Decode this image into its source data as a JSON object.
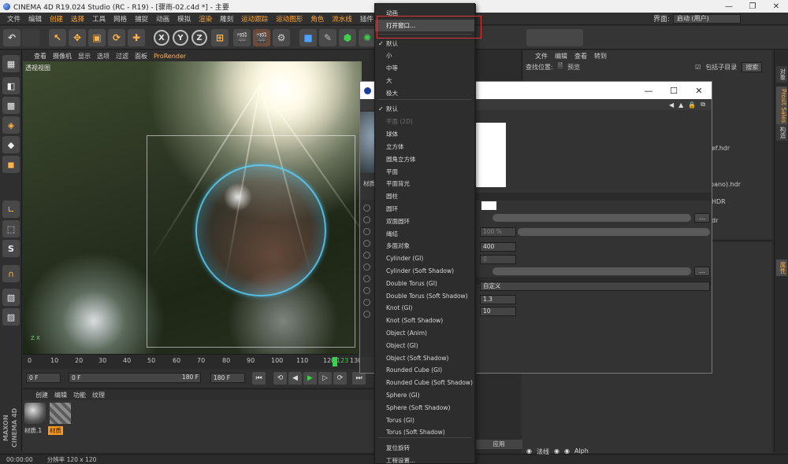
{
  "titlebar": {
    "title": "CINEMA 4D R19.024 Studio (RC - R19) - [骤雨-02.c4d *] - 主要",
    "controls": [
      "—",
      "❐",
      "✕"
    ]
  },
  "menubar": {
    "items": [
      "文件",
      "编辑",
      "创建",
      "选择",
      "工具",
      "网格",
      "捕捉",
      "动画",
      "模拟",
      "渲染",
      "雕刻",
      "运动跟踪",
      "运动图形",
      "角色",
      "流水线",
      "插件",
      "Octane"
    ],
    "highlight": [
      2,
      3,
      9,
      11,
      12,
      13,
      14
    ],
    "layout_label": "界面:",
    "layout_value": "启动 (用户)"
  },
  "toolbar": {
    "xyz": [
      "X",
      "Y",
      "Z"
    ]
  },
  "viewport": {
    "menu": [
      "查看",
      "摄像机",
      "显示",
      "选项",
      "过滤",
      "面板",
      "ProRender"
    ],
    "label": "透视视图",
    "axis": "Z X"
  },
  "timeline": {
    "ticks": [
      "0",
      "10",
      "20",
      "30",
      "40",
      "50",
      "60",
      "70",
      "80",
      "90",
      "100",
      "110",
      "120",
      "123",
      "130"
    ],
    "start_frame": "0 F",
    "current_frame": "0 F",
    "range_end": "180 F",
    "end_frame": "180 F"
  },
  "material_manager": {
    "menu": [
      "创建",
      "编辑",
      "功能",
      "纹理"
    ],
    "materials": [
      {
        "label": "材质.1"
      },
      {
        "label": "材质"
      }
    ]
  },
  "logo": {
    "line1": "MAXON",
    "line2": "CINEMA 4D"
  },
  "statusbar": {
    "time": "00:00:00",
    "info": "分辨率 120 x 120"
  },
  "object_panel": {
    "menu": [
      "文件",
      "编辑",
      "查看",
      "转到"
    ],
    "search_label": "查找位置:",
    "preview": "预览",
    "subdir": "包括子目录",
    "search_btn": "搜索",
    "files": [
      "ef.hdr",
      "pano).hdr",
      "HDR",
      "dr"
    ]
  },
  "right_tabs": [
    "对象",
    "Prosit Sales",
    "构造",
    "属性"
  ],
  "attr_panel": {
    "rows": [
      "法线",
      "Alph"
    ]
  },
  "material_window": {
    "left_tab": "材质",
    "preview_value": "100 %",
    "value_400": "400",
    "value_0": "0",
    "dropdown": "自定义",
    "value_13": "1.3",
    "value_10": "10",
    "apply": "应用",
    "dots": "...",
    "controls": [
      "—",
      "☐",
      "✕"
    ]
  },
  "dropdown_menu": {
    "items": [
      {
        "label": "动画",
        "type": "normal"
      },
      {
        "label": "打开窗口...",
        "type": "hover"
      },
      {
        "label": "默认",
        "type": "checked"
      },
      {
        "label": "小",
        "type": "normal"
      },
      {
        "label": "中等",
        "type": "normal"
      },
      {
        "label": "大",
        "type": "normal"
      },
      {
        "label": "极大",
        "type": "normal"
      },
      {
        "label": "默认",
        "type": "checked"
      },
      {
        "label": "平面 (2D)",
        "type": "disabled"
      },
      {
        "label": "球体",
        "type": "normal"
      },
      {
        "label": "立方体",
        "type": "normal"
      },
      {
        "label": "圆角立方体",
        "type": "normal"
      },
      {
        "label": "平面",
        "type": "normal"
      },
      {
        "label": "平面背光",
        "type": "normal"
      },
      {
        "label": "圆柱",
        "type": "normal"
      },
      {
        "label": "圆环",
        "type": "normal"
      },
      {
        "label": "双面圆环",
        "type": "normal"
      },
      {
        "label": "绳结",
        "type": "normal"
      },
      {
        "label": "多面对象",
        "type": "normal"
      },
      {
        "label": "Cylinder (GI)",
        "type": "normal"
      },
      {
        "label": "Cylinder (Soft Shadow)",
        "type": "normal"
      },
      {
        "label": "Double Torus (GI)",
        "type": "normal"
      },
      {
        "label": "Double Torus (Soft Shadow)",
        "type": "normal"
      },
      {
        "label": "Knot (GI)",
        "type": "normal"
      },
      {
        "label": "Knot (Soft Shadow)",
        "type": "normal"
      },
      {
        "label": "Object (Anim)",
        "type": "normal"
      },
      {
        "label": "Object (GI)",
        "type": "normal"
      },
      {
        "label": "Object (Soft Shadow)",
        "type": "normal"
      },
      {
        "label": "Rounded Cube (GI)",
        "type": "normal"
      },
      {
        "label": "Rounded Cube (Soft Shadow)",
        "type": "normal"
      },
      {
        "label": "Sphere (GI)",
        "type": "normal"
      },
      {
        "label": "Sphere (Soft Shadow)",
        "type": "normal"
      },
      {
        "label": "Torus (GI)",
        "type": "normal"
      },
      {
        "label": "Torus (Soft Shadow)",
        "type": "normal"
      },
      {
        "label": "复位旋转",
        "type": "normal"
      },
      {
        "label": "工程设置...",
        "type": "normal"
      }
    ]
  },
  "colors": {
    "accent": "#ffa63a",
    "highlight_box": "#e03535",
    "timeline_cursor": "#37d14c"
  }
}
